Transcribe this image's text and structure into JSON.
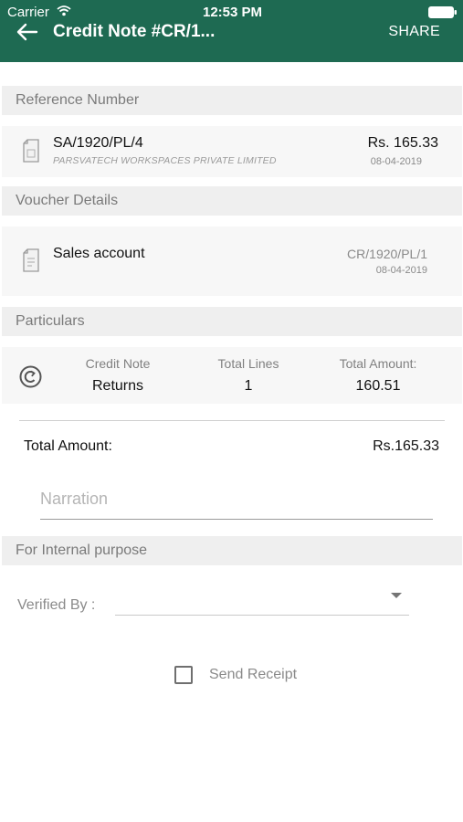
{
  "status_bar": {
    "carrier": "Carrier",
    "time": "12:53 PM"
  },
  "header": {
    "title": "Credit Note #CR/1...",
    "share_label": "SHARE",
    "back_icon": "back-arrow-icon"
  },
  "reference": {
    "section_title": "Reference Number",
    "number": "SA/1920/PL/4",
    "company": "PARSVATECH WORKSPACES PRIVATE LIMITED",
    "amount": "Rs. 165.33",
    "date": "08-04-2019"
  },
  "voucher": {
    "section_title": "Voucher Details",
    "account": "Sales account",
    "number": "CR/1920/PL/1",
    "date": "08-04-2019"
  },
  "particulars": {
    "section_title": "Particulars",
    "columns": [
      {
        "label": "Credit Note",
        "value": "Returns"
      },
      {
        "label": "Total Lines",
        "value": "1"
      },
      {
        "label": "Total Amount:",
        "value": "160.51"
      }
    ]
  },
  "total": {
    "label": "Total Amount:",
    "value": "Rs.165.33"
  },
  "narration": {
    "placeholder": "Narration"
  },
  "internal": {
    "section_title": "For Internal purpose",
    "verified_by_label": "Verified By :",
    "verified_by_value": ""
  },
  "send_receipt": {
    "label": "Send Receipt",
    "checked": false
  },
  "colors": {
    "header_bg": "#1e6a52",
    "section_bg": "#efefef",
    "card_bg": "#f7f7f7"
  }
}
